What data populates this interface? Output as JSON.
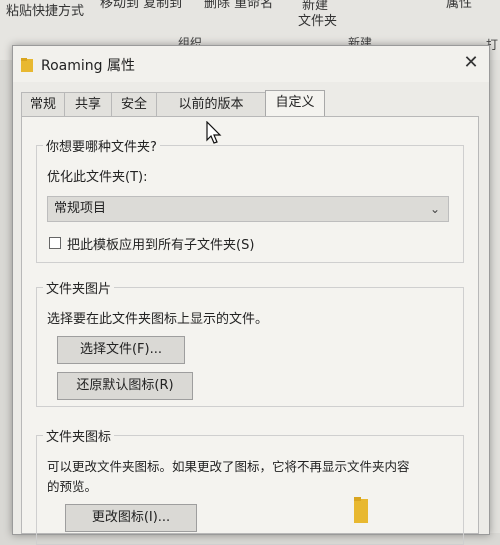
{
  "background": {
    "ribbon": {
      "paste_shortcut": "粘贴快捷方式",
      "move_copy": "移动到 复制到",
      "delete_rename": "删除 重命名",
      "new_folder_line1": "新建",
      "new_folder_line2": "文件夹",
      "properties": "属性",
      "group_organize": "组织",
      "group_new": "新建",
      "open_fragment": "打"
    }
  },
  "dialog": {
    "title": "Roaming 属性",
    "close": "✕",
    "tabs": [
      {
        "label": "常规"
      },
      {
        "label": "共享"
      },
      {
        "label": "安全"
      },
      {
        "label": "以前的版本"
      },
      {
        "label": "自定义"
      }
    ],
    "active_tab": "自定义",
    "customize": {
      "folder_type_group": "你想要哪种文件夹?",
      "optimize_label": "优化此文件夹(T):",
      "optimize_value": "常规项目",
      "apply_subfolders_label": "把此模板应用到所有子文件夹(S)",
      "apply_subfolders_checked": false,
      "folder_picture_group": "文件夹图片",
      "folder_picture_desc": "选择要在此文件夹图标上显示的文件。",
      "choose_file_button": "选择文件(F)...",
      "restore_default_button": "还原默认图标(R)",
      "folder_icon_group": "文件夹图标",
      "folder_icon_desc_line1": "可以更改文件夹图标。如果更改了图标，它将不再显示文件夹内容",
      "folder_icon_desc_line2": "的预览。",
      "change_icon_button": "更改图标(I)..."
    }
  },
  "colors": {
    "dialog_bg": "#ecebe7",
    "panel_bg": "#f4f3ef",
    "button_bg": "#dad9d5",
    "folder_yellow": "#e8b830"
  }
}
